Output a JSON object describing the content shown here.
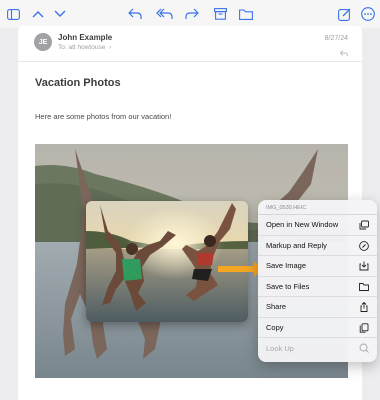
{
  "toolbar": {
    "icons": [
      "sidebar-icon",
      "chevron-up-icon",
      "chevron-down-icon",
      "reply-icon",
      "reply-all-icon",
      "forward-icon",
      "archive-icon",
      "folder-icon",
      "compose-icon",
      "more-icon"
    ]
  },
  "email": {
    "avatar_initials": "JE",
    "sender": "John Example",
    "to": "To: att howtouse",
    "date": "8/27/24",
    "subject": "Vacation Photos",
    "body": "Here are some photos from our vacation!"
  },
  "context_menu": {
    "file_name": "IMG_0530.HEIC",
    "items": [
      {
        "label": "Open in New Window",
        "icon": "new-window-icon",
        "enabled": true
      },
      {
        "label": "Markup and Reply",
        "icon": "markup-icon",
        "enabled": true
      },
      {
        "label": "Save Image",
        "icon": "save-image-icon",
        "enabled": true
      },
      {
        "label": "Save to Files",
        "icon": "folder-icon",
        "enabled": true
      },
      {
        "label": "Share",
        "icon": "share-icon",
        "enabled": true
      },
      {
        "label": "Copy",
        "icon": "copy-icon",
        "enabled": true
      },
      {
        "label": "Look Up",
        "icon": "look-up-icon",
        "enabled": false
      }
    ]
  },
  "colors": {
    "accent": "#3a74e8",
    "highlight_arrow": "#f5a623"
  }
}
